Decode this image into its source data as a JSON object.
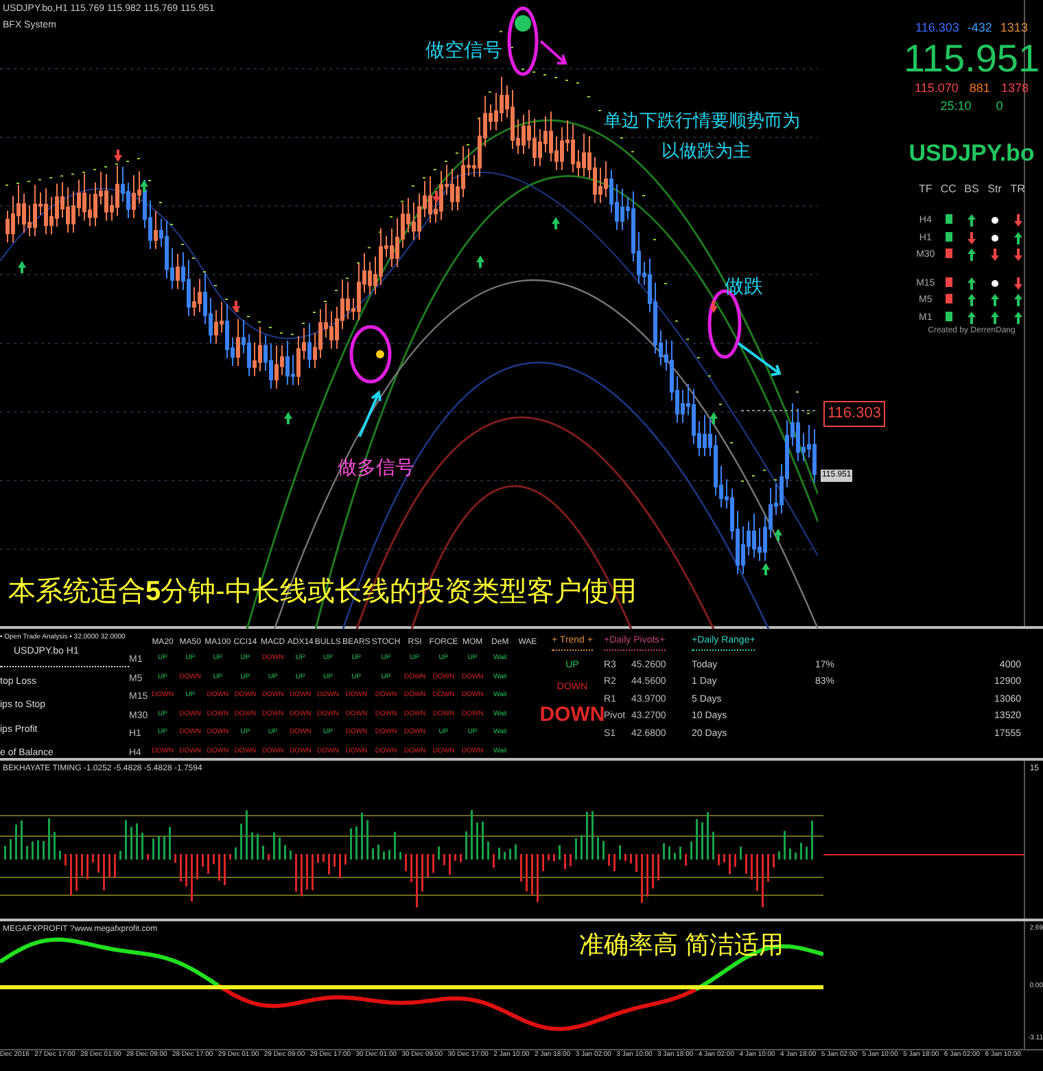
{
  "main_chart": {
    "header": "USDJPY.bo,H1  115.769 115.982 115.769 115.951",
    "subheader": "BFX System",
    "annotations": [
      "做空信号",
      "单边下跌行情要顺势而为",
      "以做跌为主",
      "做跌",
      "做多信号",
      "本系统适合**5**分钟-中长线或长线的投资类型客户使用"
    ],
    "price_tags": [
      {
        "kind": "boxed",
        "text": "116.303"
      },
      {
        "kind": "small",
        "text": "115.951"
      }
    ]
  },
  "info_panel": {
    "top_row": [
      "116.303",
      "-432",
      "1313"
    ],
    "price": "115.951",
    "mid_row": [
      "115.070",
      "881",
      "1378"
    ],
    "time_row": [
      "25:10",
      "0"
    ],
    "symbol": "USDJPY.bo",
    "columns": [
      "TF",
      "CC",
      "BS",
      "Str",
      "TR"
    ],
    "rows": [
      {
        "tf": "H4",
        "cc": {
          "up": true
        },
        "bs": {
          "kind": "arrow",
          "up": true
        },
        "str": {
          "kind": "dot"
        },
        "tr": {
          "kind": "arrow",
          "up": false
        }
      },
      {
        "tf": "H1",
        "cc": {
          "up": true
        },
        "bs": {
          "kind": "arrow",
          "up": false
        },
        "str": {
          "kind": "dot"
        },
        "tr": {
          "kind": "arrow",
          "up": true
        }
      },
      {
        "tf": "M30",
        "cc": {
          "up": false
        },
        "bs": {
          "kind": "arrow",
          "up": true
        },
        "str": {
          "kind": "arrow",
          "up": false
        },
        "tr": {
          "kind": "arrow",
          "up": false
        }
      },
      {
        "tf": "M15",
        "cc": {
          "up": false
        },
        "bs": {
          "kind": "arrow",
          "up": true
        },
        "str": {
          "kind": "dot"
        },
        "tr": {
          "kind": "arrow",
          "up": false
        }
      },
      {
        "tf": "M5",
        "cc": {
          "up": false
        },
        "bs": {
          "kind": "arrow",
          "up": true
        },
        "str": {
          "kind": "arrow",
          "up": true
        },
        "tr": {
          "kind": "arrow",
          "up": true
        }
      },
      {
        "tf": "M1",
        "cc": {
          "up": true
        },
        "bs": {
          "kind": "arrow",
          "up": true
        },
        "str": {
          "kind": "arrow",
          "up": true
        },
        "tr": {
          "kind": "arrow",
          "up": true
        }
      }
    ],
    "credit": "Created by DerrenDang"
  },
  "analysis": {
    "title": "• Open Trade Analysis • 32.0000 32.0000",
    "subtitle": "USDJPY.bo  H1",
    "side_labels": [
      "top Loss",
      "ips to Stop",
      "ips Profit",
      "e of Balance"
    ],
    "columns": [
      "MA20",
      "MA50",
      "MA100",
      "CCI14",
      "MACD",
      "ADX14",
      "BULLS",
      "BEARS",
      "STOCH",
      "RSI",
      "FORCE",
      "MOM",
      "DeM",
      "WAE"
    ],
    "rows": [
      {
        "tf": "M1",
        "cells": [
          {
            "text": "UP",
            "up": true
          },
          {
            "text": "UP",
            "up": true
          },
          {
            "text": "UP",
            "up": true
          },
          {
            "text": "UP",
            "up": true
          },
          {
            "text": "DOWN",
            "up": false
          },
          {
            "text": "UP",
            "up": true
          },
          {
            "text": "UP",
            "up": true
          },
          {
            "text": "UP",
            "up": true
          },
          {
            "text": "UP",
            "up": true
          },
          {
            "text": "UP",
            "up": true
          },
          {
            "text": "UP",
            "up": true
          },
          {
            "text": "UP",
            "up": true
          },
          {
            "text": "Wait",
            "up": true
          }
        ]
      },
      {
        "tf": "M5",
        "cells": [
          {
            "text": "UP",
            "up": true
          },
          {
            "text": "DOWN",
            "up": false
          },
          {
            "text": "UP",
            "up": true
          },
          {
            "text": "UP",
            "up": true
          },
          {
            "text": "UP",
            "up": true
          },
          {
            "text": "UP",
            "up": true
          },
          {
            "text": "UP",
            "up": true
          },
          {
            "text": "UP",
            "up": true
          },
          {
            "text": "UP",
            "up": true
          },
          {
            "text": "DOWN",
            "up": false
          },
          {
            "text": "DOWN",
            "up": false
          },
          {
            "text": "DOWN",
            "up": false
          },
          {
            "text": "Wait",
            "up": true
          }
        ]
      },
      {
        "tf": "M15",
        "cells": [
          {
            "text": "DOWN",
            "up": false
          },
          {
            "text": "UP",
            "up": true
          },
          {
            "text": "DOWN",
            "up": false
          },
          {
            "text": "DOWN",
            "up": false
          },
          {
            "text": "DOWN",
            "up": false
          },
          {
            "text": "DOWN",
            "up": false
          },
          {
            "text": "DOWN",
            "up": false
          },
          {
            "text": "DOWN",
            "up": false
          },
          {
            "text": "DOWN",
            "up": false
          },
          {
            "text": "DOWN",
            "up": false
          },
          {
            "text": "DOWN",
            "up": false
          },
          {
            "text": "DOWN",
            "up": false
          },
          {
            "text": "Wait",
            "up": true
          }
        ]
      },
      {
        "tf": "M30",
        "cells": [
          {
            "text": "UP",
            "up": true
          },
          {
            "text": "DOWN",
            "up": false
          },
          {
            "text": "DOWN",
            "up": false
          },
          {
            "text": "DOWN",
            "up": false
          },
          {
            "text": "DOWN",
            "up": false
          },
          {
            "text": "DOWN",
            "up": false
          },
          {
            "text": "DOWN",
            "up": false
          },
          {
            "text": "DOWN",
            "up": false
          },
          {
            "text": "DOWN",
            "up": false
          },
          {
            "text": "DOWN",
            "up": false
          },
          {
            "text": "DOWN",
            "up": false
          },
          {
            "text": "DOWN",
            "up": false
          },
          {
            "text": "Wait",
            "up": true
          }
        ]
      },
      {
        "tf": "H1",
        "cells": [
          {
            "text": "UP",
            "up": true
          },
          {
            "text": "DOWN",
            "up": false
          },
          {
            "text": "DOWN",
            "up": false
          },
          {
            "text": "UP",
            "up": true
          },
          {
            "text": "UP",
            "up": true
          },
          {
            "text": "DOWN",
            "up": false
          },
          {
            "text": "UP",
            "up": true
          },
          {
            "text": "DOWN",
            "up": false
          },
          {
            "text": "DOWN",
            "up": false
          },
          {
            "text": "DOWN",
            "up": false
          },
          {
            "text": "UP",
            "up": true
          },
          {
            "text": "UP",
            "up": true
          },
          {
            "text": "Wait",
            "up": true
          }
        ]
      },
      {
        "tf": "H4",
        "cells": [
          {
            "text": "DOWN",
            "up": false
          },
          {
            "text": "DOWN",
            "up": false
          },
          {
            "text": "DOWN",
            "up": false
          },
          {
            "text": "DOWN",
            "up": false
          },
          {
            "text": "DOWN",
            "up": false
          },
          {
            "text": "DOWN",
            "up": false
          },
          {
            "text": "DOWN",
            "up": false
          },
          {
            "text": "DOWN",
            "up": false
          },
          {
            "text": "DOWN",
            "up": false
          },
          {
            "text": "DOWN",
            "up": false
          },
          {
            "text": "DOWN",
            "up": false
          },
          {
            "text": "DOWN",
            "up": false
          },
          {
            "text": "Wait",
            "up": true
          }
        ]
      }
    ],
    "trend": {
      "title": "+ Trend +",
      "items": [
        {
          "text": "UP",
          "up": true
        },
        {
          "text": "DOWN",
          "up": false
        }
      ],
      "verdict": {
        "text": "DOWN",
        "up": false
      }
    },
    "pivots": {
      "title": "+Daily Pivots+",
      "rows": [
        {
          "label": "R3",
          "value": "45.2600"
        },
        {
          "label": "R2",
          "value": "44.5600"
        },
        {
          "label": "R1",
          "value": "43.9700"
        },
        {
          "label": "Pivot",
          "value": "43.2700"
        },
        {
          "label": "S1",
          "value": "42.6800"
        }
      ]
    },
    "range": {
      "title": "+Daily Range+",
      "rows": [
        {
          "label": "Today",
          "pct": "17%",
          "value": "4000"
        },
        {
          "label": "1 Day",
          "pct": "83%",
          "value": "12900"
        },
        {
          "label": "5 Days",
          "value": "13060"
        },
        {
          "label": "10 Days",
          "value": "13520"
        },
        {
          "label": "20 Days",
          "value": "17555"
        }
      ]
    }
  },
  "timing_panel": {
    "title": "BEKHAYATE TIMING  -1.0252 -5.4828 -5.4828 -1.7594",
    "axis_label": "15"
  },
  "oscillator_panel": {
    "title": "MEGAFXPROFIT ?www.megafxprofit.com",
    "annotation": "准确率高 简洁适用",
    "axis_labels": [
      "2.69",
      "0.00",
      "-3.11"
    ]
  },
  "time_axis": [
    "Dec 2016",
    "27 Dec 17:00",
    "28 Dec 01:00",
    "28 Dec 09:00",
    "28 Dec 17:00",
    "29 Dec 01:00",
    "29 Dec 09:00",
    "29 Dec 17:00",
    "30 Dec 01:00",
    "30 Dec 09:00",
    "30 Dec 17:00",
    "2 Jan 10:00",
    "2 Jan 18:00",
    "3 Jan 02:00",
    "3 Jan 10:00",
    "3 Jan 18:00",
    "4 Jan 02:00",
    "4 Jan 10:00",
    "4 Jan 18:00",
    "5 Jan 02:00",
    "5 Jan 10:00",
    "5 Jan 18:00",
    "6 Jan 02:00",
    "6 Jan 10:00"
  ]
}
